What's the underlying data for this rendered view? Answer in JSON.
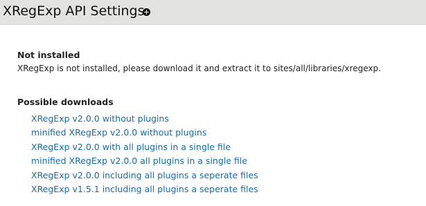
{
  "header": {
    "title": "XRegExp API Settings",
    "shortcut_icon": "add-shortcut-icon",
    "background_color": "#e3e3e1"
  },
  "status": {
    "heading": "Not installed",
    "message": "XRegExp is not installed, please download it and extract it to sites/all/libraries/xregexp."
  },
  "downloads": {
    "heading": "Possible downloads",
    "link_color": "#0f6db0",
    "items": [
      {
        "label": "XRegExp v2.0.0 without plugins"
      },
      {
        "label": "minified XRegExp v2.0.0 without plugins"
      },
      {
        "label": "XRegExp v2.0.0 with all plugins in a single file"
      },
      {
        "label": "minified XRegExp v2.0.0 all plugins in a single file"
      },
      {
        "label": "XRegExp v2.0.0 including all plugins a seperate files"
      },
      {
        "label": "XRegExp v1.5.1 including all plugins a seperate files"
      }
    ]
  }
}
